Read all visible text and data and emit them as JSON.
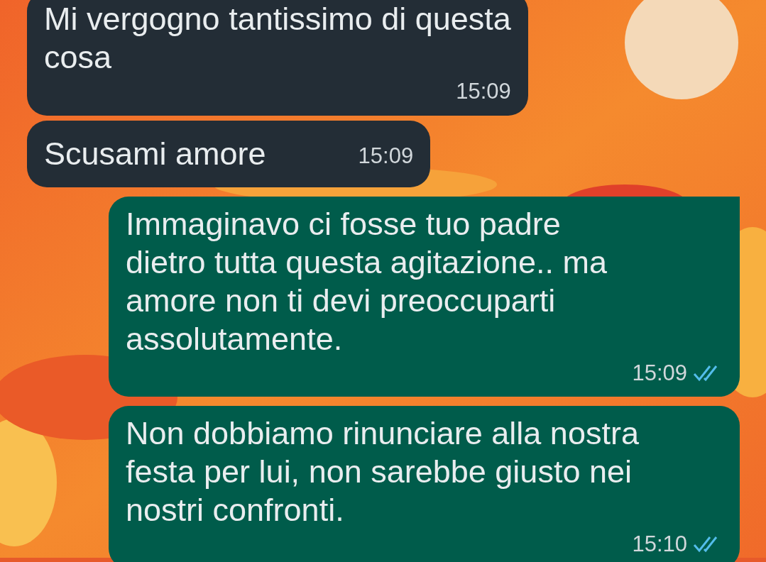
{
  "messages": [
    {
      "kind": "incoming",
      "lines": [
        "Mi vergogno tantissimo di questa",
        "cosa"
      ],
      "time": "15:09"
    },
    {
      "kind": "incoming",
      "lines": [
        "Scusami amore"
      ],
      "time": "15:09"
    },
    {
      "kind": "outgoing",
      "lines": [
        "Immaginavo ci fosse tuo padre",
        "dietro tutta questa agitazione..  ma",
        "amore non ti devi preoccuparti",
        "assolutamente."
      ],
      "time": "15:09",
      "read": true,
      "tail": true
    },
    {
      "kind": "outgoing",
      "lines": [
        "Non dobbiamo rinunciare alla nostra",
        "festa per lui, non sarebbe giusto nei",
        "nostri confronti."
      ],
      "time": "15:10",
      "read": true,
      "tail": false
    }
  ]
}
